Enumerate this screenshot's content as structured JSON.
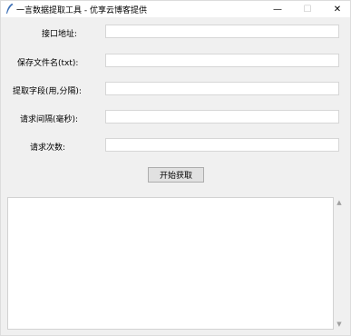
{
  "window": {
    "title": "一言数据提取工具 - 优享云博客提供",
    "controls": {
      "minimize": "—",
      "maximize": "☐",
      "close": "✕"
    }
  },
  "form": {
    "api_url_label": "接口地址:",
    "save_filename_label": "保存文件名(txt):",
    "extract_fields_label": "提取字段(用,分隔):",
    "request_interval_label": "请求间隔(毫秒):",
    "request_count_label": "请求次数:",
    "api_url_value": "",
    "save_filename_value": "",
    "extract_fields_value": "",
    "request_interval_value": "",
    "request_count_value": ""
  },
  "actions": {
    "start_label": "开始获取"
  },
  "output": {
    "text": ""
  },
  "scrollbar": {
    "up": "▲",
    "down": "▼"
  }
}
